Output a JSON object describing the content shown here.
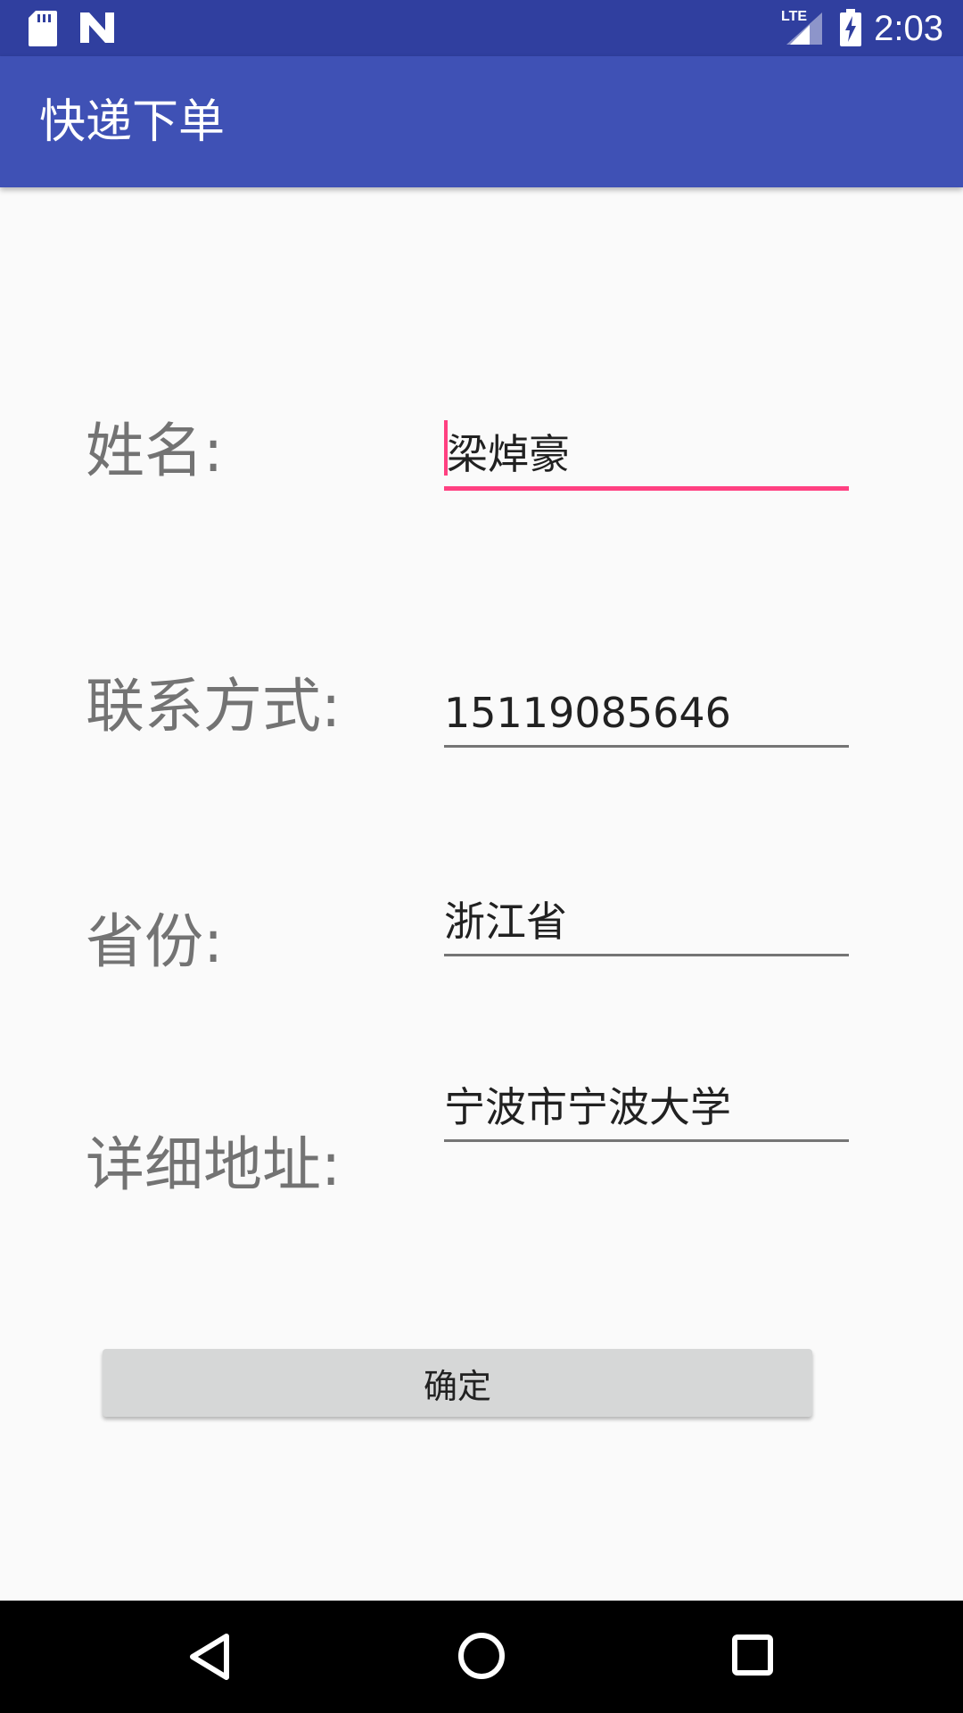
{
  "status_bar": {
    "time": "2:03",
    "network": "LTE",
    "icons": [
      "sd-card-icon",
      "notification-n-icon",
      "lte-signal-icon",
      "battery-charging-icon"
    ]
  },
  "app_bar": {
    "title": "快递下单"
  },
  "form": {
    "name_label": "姓名:",
    "name_value": "梁焯豪",
    "phone_label": "联系方式:",
    "phone_value": "15119085646",
    "province_label": "省份:",
    "province_value": "浙江省",
    "address_label": "详细地址:",
    "address_value": "宁波市宁波大学",
    "submit_label": "确定"
  },
  "nav_bar": {
    "icons": [
      "back-icon",
      "home-icon",
      "recents-icon"
    ]
  },
  "colors": {
    "status_bar": "#303f9f",
    "app_bar": "#3f51b5",
    "accent": "#ff4081",
    "background": "#fafafa"
  }
}
